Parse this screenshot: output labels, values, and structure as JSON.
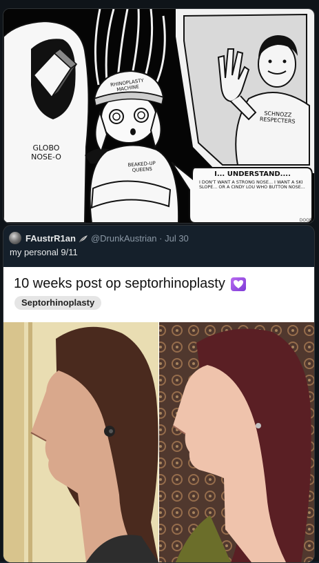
{
  "comic": {
    "globo_label": "GLOBO NOSE-O",
    "helmet_label": "RHINOPLASTY MACHINE",
    "shirt_left_label": "BEAKED-UP QUEENS",
    "shirt_right_label": "SCHNOZZ RESPECTERS",
    "speech_title": "I... UNDERSTAND....",
    "speech_body": "I DON'T WANT A STRONG NOSE... I WANT A SKI SLOPE... OR A CINDY LOU WHO BUTTON NOSE...",
    "corner_text": "DOOR"
  },
  "quote_tweet": {
    "display_name": "FAustrR1an",
    "badge_icon": "feather-emoji-icon",
    "handle_date": "@DrunkAustrian · Jul 30",
    "text": "my personal 9/11",
    "embedded": {
      "title": "10 weeks post op septorhinoplasty",
      "title_emoji": "purple-heart-icon",
      "tag": "Septorhinoplasty"
    }
  },
  "colors": {
    "background": "#0f1419",
    "card_border": "#2f3336",
    "text_primary": "#e7e9ea",
    "text_secondary": "#8b98a5",
    "heart": "#9b4fe0"
  }
}
